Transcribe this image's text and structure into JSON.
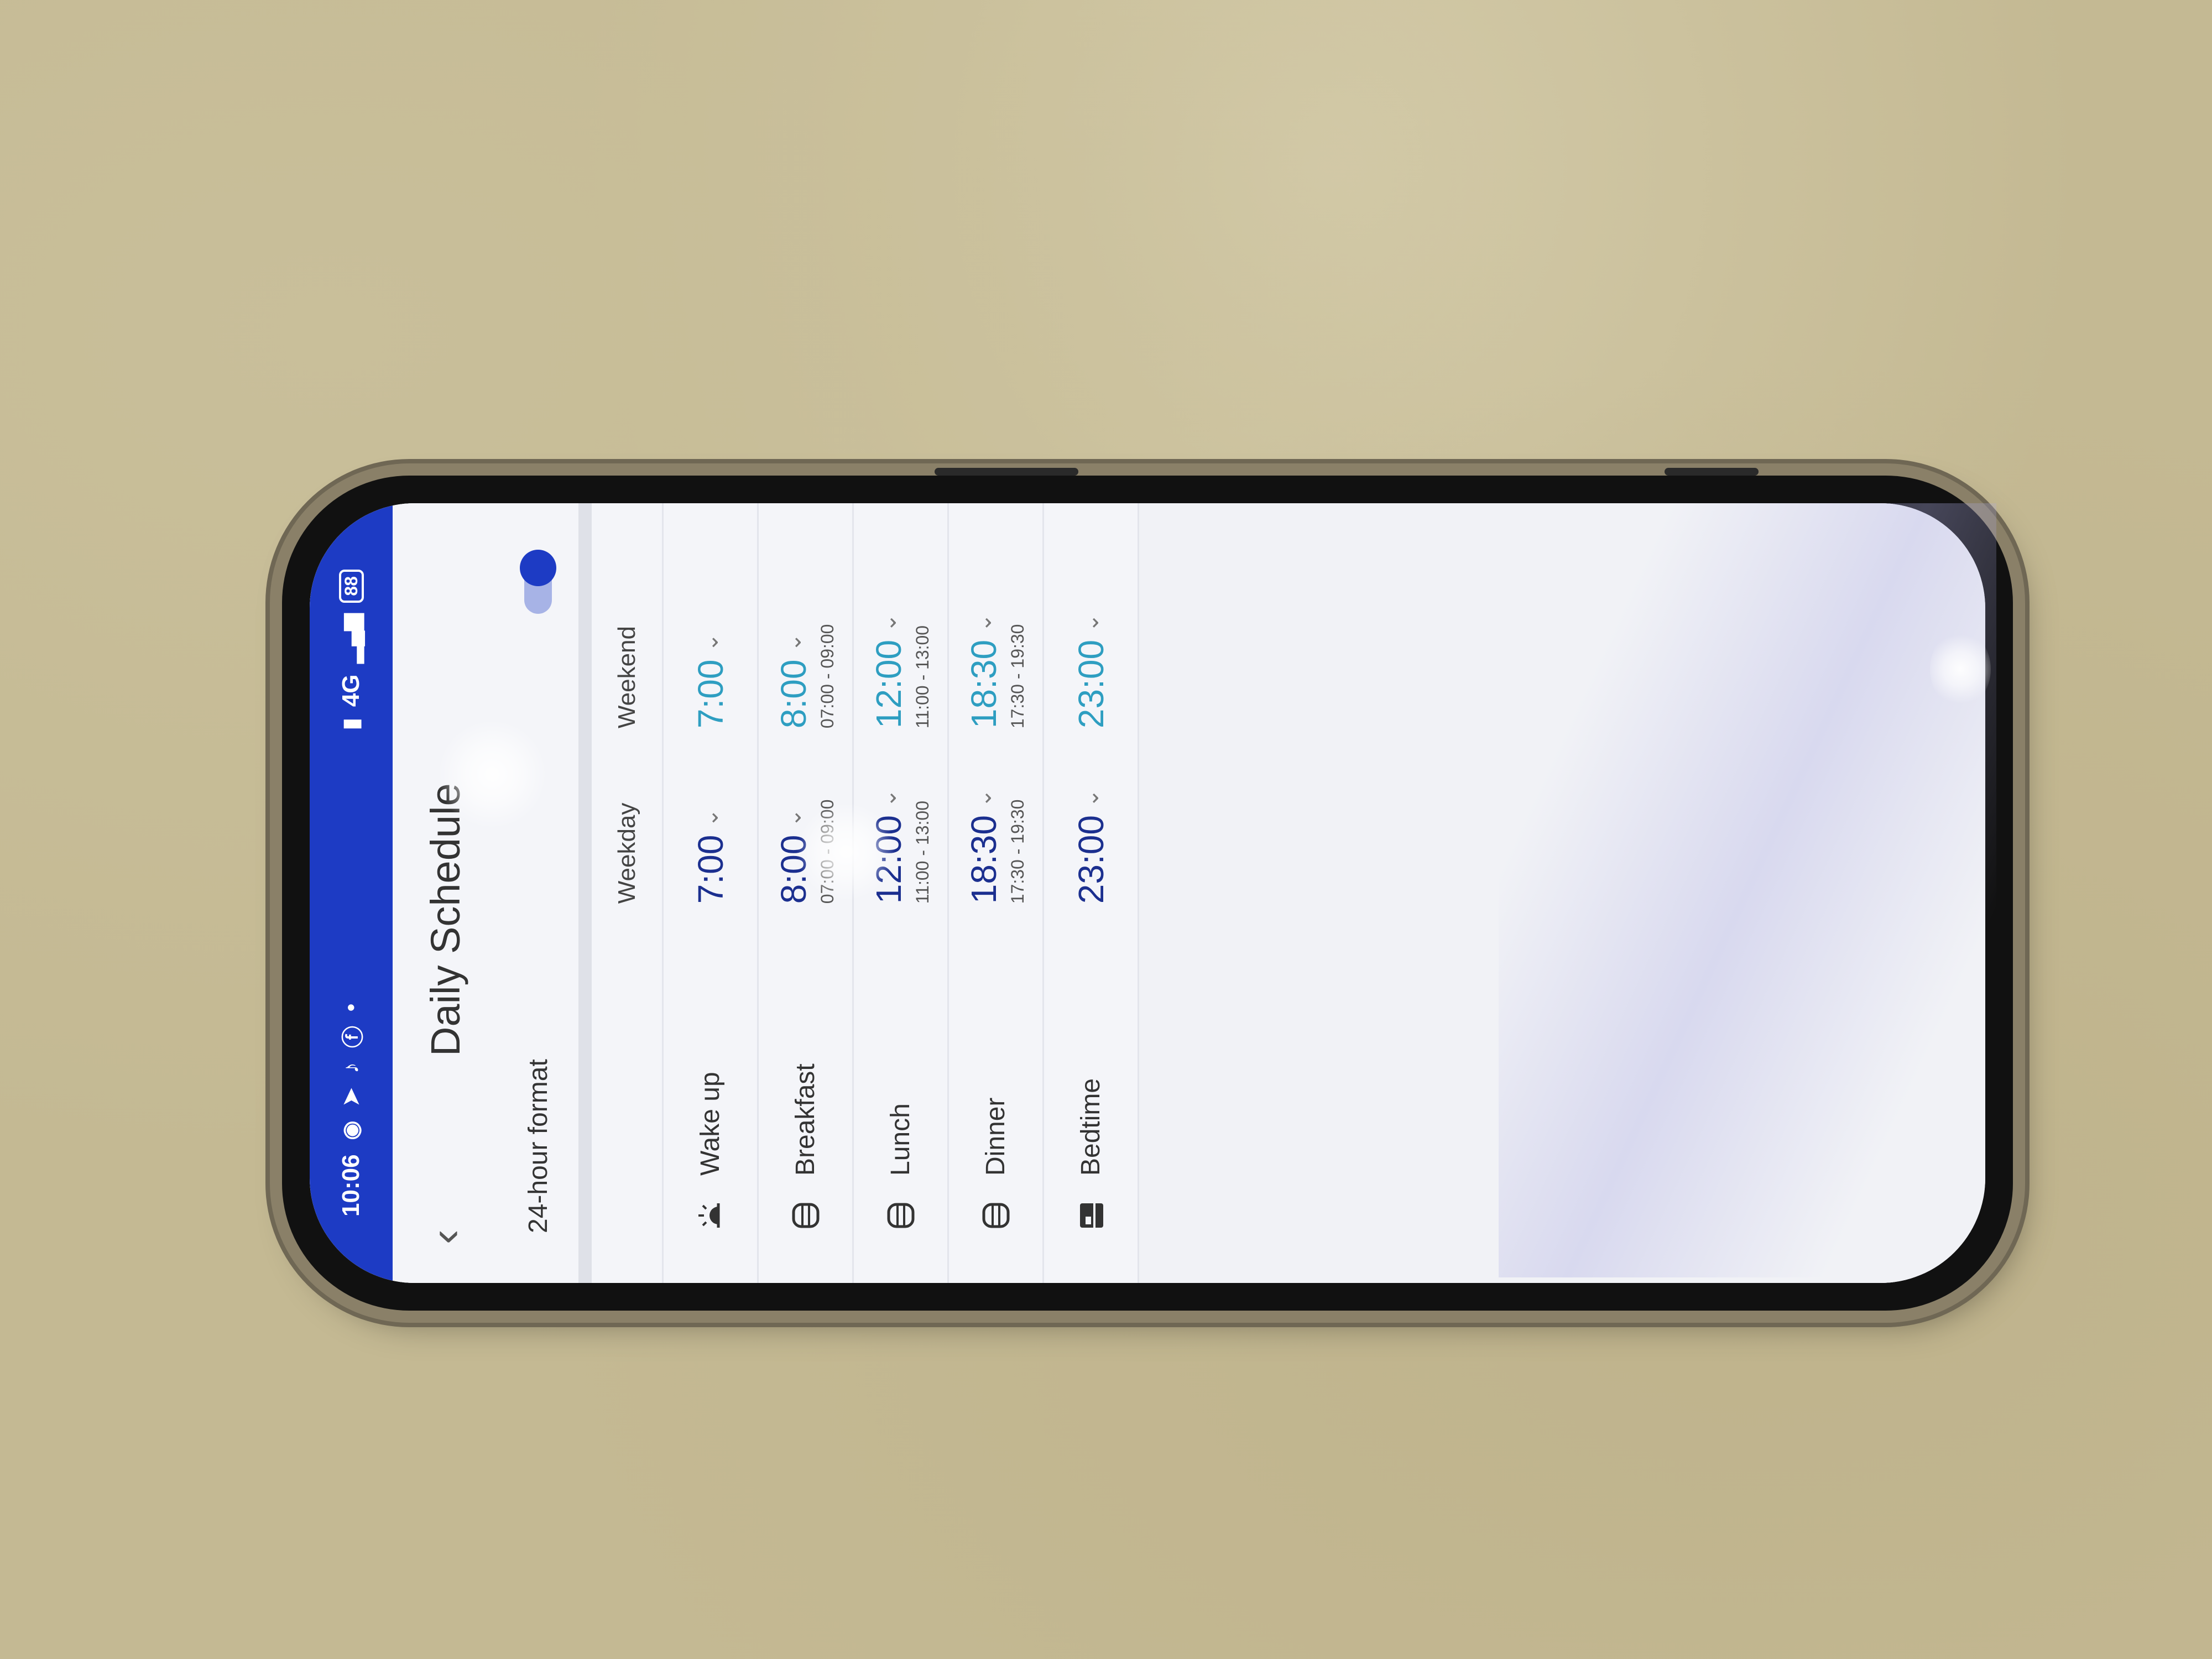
{
  "status_bar": {
    "time": "10:06",
    "network": "4G",
    "battery": "88"
  },
  "app_bar": {
    "title": "Daily Schedule",
    "back_icon": "chevron-left-icon"
  },
  "settings": {
    "format_label": "24-hour format",
    "format_enabled": true
  },
  "table": {
    "headers": {
      "weekday": "Weekday",
      "weekend": "Weekend"
    },
    "rows": [
      {
        "label": "Wake up",
        "icon": "sunrise-icon",
        "weekday_time": "7:00",
        "weekday_range": "",
        "weekend_time": "7:00",
        "weekend_range": ""
      },
      {
        "label": "Breakfast",
        "icon": "meal-icon",
        "weekday_time": "8:00",
        "weekday_range": "07:00 - 09:00",
        "weekend_time": "8:00",
        "weekend_range": "07:00 - 09:00"
      },
      {
        "label": "Lunch",
        "icon": "meal-icon",
        "weekday_time": "12:00",
        "weekday_range": "11:00 - 13:00",
        "weekend_time": "12:00",
        "weekend_range": "11:00 - 13:00"
      },
      {
        "label": "Dinner",
        "icon": "meal-icon",
        "weekday_time": "18:30",
        "weekday_range": "17:30 - 19:30",
        "weekend_time": "18:30",
        "weekend_range": "17:30 - 19:30"
      },
      {
        "label": "Bedtime",
        "icon": "bed-icon",
        "weekday_time": "23:00",
        "weekday_range": "",
        "weekend_time": "23:00",
        "weekend_range": ""
      }
    ]
  },
  "colors": {
    "status_bar": "#1d3bc4",
    "weekday_time": "#1b2f8f",
    "weekend_time": "#2e9ec1"
  }
}
